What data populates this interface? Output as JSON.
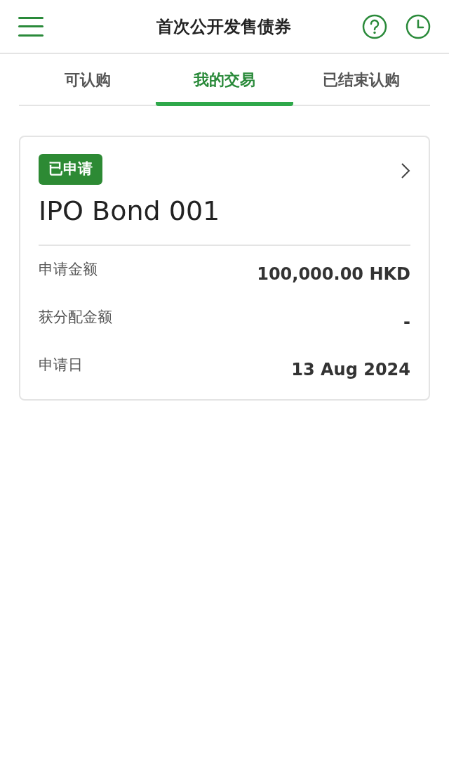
{
  "header": {
    "title": "首次公开发售债券"
  },
  "tabs": [
    {
      "label": "可认购",
      "selected": false
    },
    {
      "label": "我的交易",
      "selected": true
    },
    {
      "label": "已结束认购",
      "selected": false
    }
  ],
  "cards": [
    {
      "badge": "已申请",
      "title": "IPO Bond 001",
      "rows": [
        {
          "label": "申请金额",
          "value": "100,000.00 HKD"
        },
        {
          "label": "获分配金额",
          "value": "-"
        },
        {
          "label": "申请日",
          "value": "13 Aug 2024"
        }
      ]
    }
  ]
}
